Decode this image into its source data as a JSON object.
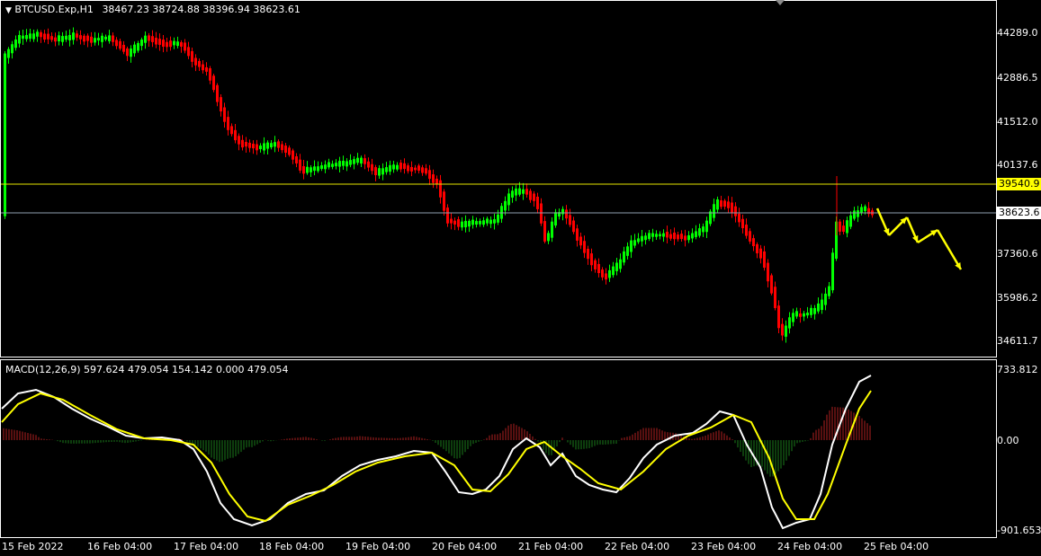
{
  "header": {
    "symbol_timeframe": "BTCUSD.Exp,H1",
    "ohlc": "38467.23 38724.88 38396.94 38623.61"
  },
  "price_axis": [
    "44289.0",
    "42886.5",
    "41512.0",
    "40137.6",
    "37360.6",
    "35986.2",
    "34611.7"
  ],
  "price_lines": [
    {
      "label": "39540.9",
      "color": "#ffff00"
    },
    {
      "label": "38623.6",
      "color": "#a0a0a0"
    }
  ],
  "macd": {
    "label": "MACD(12,26,9) 597.624 479.054 154.142 0.000 479.054",
    "axis": [
      "733.812",
      "0.00",
      "-901.653"
    ]
  },
  "time_axis": [
    "15 Feb 2022",
    "16 Feb 04:00",
    "17 Feb 04:00",
    "18 Feb 04:00",
    "19 Feb 04:00",
    "20 Feb 04:00",
    "21 Feb 04:00",
    "22 Feb 04:00",
    "23 Feb 04:00",
    "24 Feb 04:00",
    "25 Feb 04:00"
  ],
  "colors": {
    "bull": "#00ff00",
    "bear": "#ff0000",
    "macd_line": "#ffffff",
    "signal_line": "#ffff00",
    "arrows": "#ffff00"
  },
  "icons": [
    "dropdown-triangle-icon"
  ]
}
